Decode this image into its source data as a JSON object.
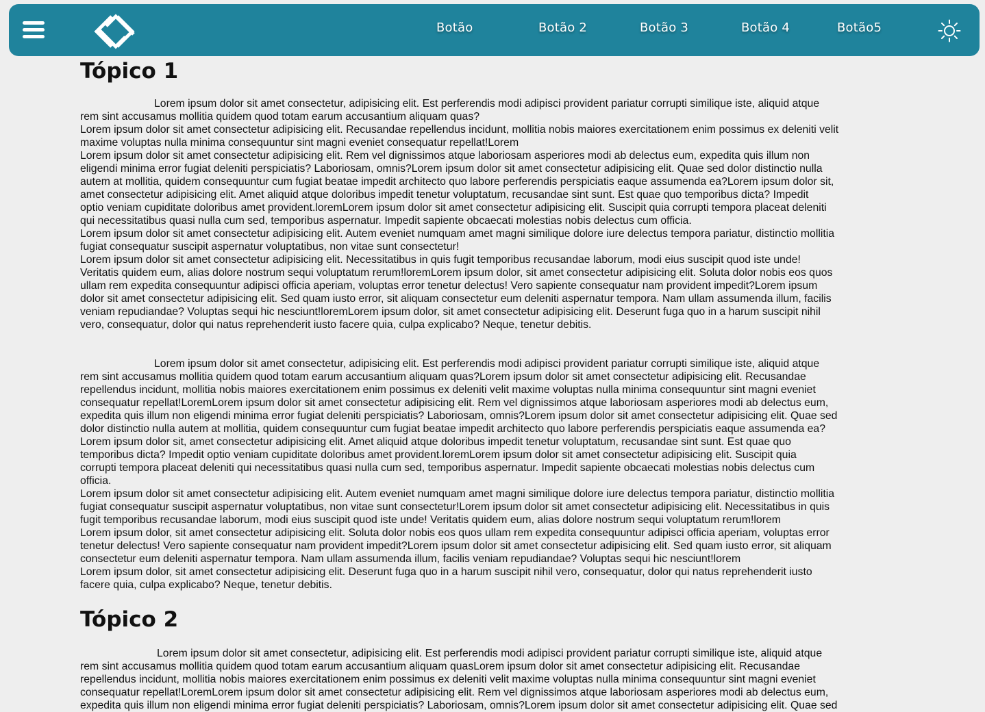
{
  "header": {
    "buttons": [
      "Botão",
      "Botão 2",
      "Botão 3",
      "Botão 4",
      "Botão5"
    ],
    "icons": {
      "menu": "hamburger-menu-icon",
      "logo": "diamond-logo",
      "theme": "sun-icon"
    },
    "colors": {
      "navbar": "#1f839c",
      "background": "#eeeeee"
    }
  },
  "topic1": {
    "title": "Tópico 1",
    "paragraph1": [
      "Lorem ipsum dolor sit amet consectetur, adipisicing elit. Est perferendis modi adipisci provident pariatur corrupti similique iste, aliquid atque",
      "rem sint accusamus mollitia quidem quod totam earum accusantium aliquam quas?",
      "Lorem ipsum dolor sit amet consectetur adipisicing elit. Recusandae repellendus incidunt, mollitia nobis maiores exercitationem enim possimus ex deleniti velit",
      "maxime voluptas nulla minima consequuntur sint magni eveniet consequatur repellat!Lorem",
      "Lorem ipsum dolor sit amet consectetur adipisicing elit. Rem vel dignissimos atque laboriosam asperiores modi ab delectus eum, expedita quis illum non",
      "eligendi minima error fugiat deleniti perspiciatis? Laboriosam, omnis?Lorem ipsum dolor sit amet consectetur adipisicing elit. Quae sed dolor distinctio nulla",
      "autem at mollitia, quidem consequuntur cum fugiat beatae impedit architecto quo labore perferendis perspiciatis eaque assumenda ea?Lorem ipsum dolor sit,",
      "amet consectetur adipisicing elit. Amet aliquid atque doloribus impedit tenetur voluptatum, recusandae sint sunt. Est quae quo temporibus dicta? Impedit",
      "optio veniam cupiditate doloribus amet provident.loremLorem ipsum dolor sit amet consectetur adipisicing elit. Suscipit quia corrupti tempora placeat deleniti",
      "qui necessitatibus quasi nulla cum sed, temporibus aspernatur. Impedit sapiente obcaecati molestias nobis delectus cum officia.",
      "Lorem ipsum dolor sit amet consectetur adipisicing elit. Autem eveniet numquam amet magni similique dolore iure delectus tempora pariatur, distinctio mollitia",
      "fugiat consequatur suscipit aspernatur voluptatibus, non vitae sunt consectetur!",
      "Lorem ipsum dolor sit amet consectetur adipisicing elit. Necessitatibus in quis fugit temporibus recusandae laborum, modi eius suscipit quod iste unde!",
      "Veritatis quidem eum, alias dolore nostrum sequi voluptatum rerum!loremLorem ipsum dolor, sit amet consectetur adipisicing elit. Soluta dolor nobis eos quos",
      "ullam rem expedita consequuntur adipisci officia aperiam, voluptas error tenetur delectus! Vero sapiente consequatur nam provident impedit?Lorem ipsum",
      "dolor sit amet consectetur adipisicing elit. Sed quam iusto error, sit aliquam consectetur eum deleniti aspernatur tempora. Nam ullam assumenda illum, facilis",
      "veniam repudiandae? Voluptas sequi hic nesciunt!loremLorem ipsum dolor, sit amet consectetur adipisicing elit. Deserunt fuga quo in a harum suscipit nihil",
      "vero, consequatur, dolor qui natus reprehenderit iusto facere quia, culpa explicabo? Neque, tenetur debitis."
    ],
    "paragraph2": [
      "Lorem ipsum dolor sit amet consectetur, adipisicing elit. Est perferendis modi adipisci provident pariatur corrupti similique iste, aliquid atque",
      "rem sint accusamus mollitia quidem quod totam earum accusantium aliquam quas?Lorem ipsum dolor sit amet consectetur adipisicing elit. Recusandae",
      "repellendus incidunt, mollitia nobis maiores exercitationem enim possimus ex deleniti velit maxime voluptas nulla minima consequuntur sint magni eveniet",
      "consequatur repellat!LoremLorem ipsum dolor sit amet consectetur adipisicing elit. Rem vel dignissimos atque laboriosam asperiores modi ab delectus eum,",
      "expedita quis illum non eligendi minima error fugiat deleniti perspiciatis? Laboriosam, omnis?Lorem ipsum dolor sit amet consectetur adipisicing elit. Quae sed",
      "dolor distinctio nulla autem at mollitia, quidem consequuntur cum fugiat beatae impedit architecto quo labore perferendis perspiciatis eaque assumenda ea?",
      "Lorem ipsum dolor sit, amet consectetur adipisicing elit. Amet aliquid atque doloribus impedit tenetur voluptatum, recusandae sint sunt. Est quae quo",
      "temporibus dicta? Impedit optio veniam cupiditate doloribus amet provident.loremLorem ipsum dolor sit amet consectetur adipisicing elit. Suscipit quia",
      "corrupti tempora placeat deleniti qui necessitatibus quasi nulla cum sed, temporibus aspernatur. Impedit sapiente obcaecati molestias nobis delectus cum",
      "officia.",
      "Lorem ipsum dolor sit amet consectetur adipisicing elit. Autem eveniet numquam amet magni similique dolore iure delectus tempora pariatur, distinctio mollitia",
      "fugiat consequatur suscipit aspernatur voluptatibus, non vitae sunt consectetur!Lorem ipsum dolor sit amet consectetur adipisicing elit. Necessitatibus in quis",
      "fugit temporibus recusandae laborum, modi eius suscipit quod iste unde! Veritatis quidem eum, alias dolore nostrum sequi voluptatum rerum!lorem",
      "Lorem ipsum dolor, sit amet consectetur adipisicing elit. Soluta dolor nobis eos quos ullam rem expedita consequuntur adipisci officia aperiam, voluptas error",
      "tenetur delectus! Vero sapiente consequatur nam provident impedit?Lorem ipsum dolor sit amet consectetur adipisicing elit. Sed quam iusto error, sit aliquam",
      "consectetur eum deleniti aspernatur tempora. Nam ullam assumenda illum, facilis veniam repudiandae? Voluptas sequi hic nesciunt!lorem",
      "Lorem ipsum dolor, sit amet consectetur adipisicing elit. Deserunt fuga quo in a harum suscipit nihil vero, consequatur, dolor qui natus reprehenderit iusto",
      "facere quia, culpa explicabo? Neque, tenetur debitis."
    ]
  },
  "topic2": {
    "title": "Tópico 2",
    "paragraph1": [
      "Lorem ipsum dolor sit amet consectetur, adipisicing elit. Est perferendis modi adipisci provident pariatur corrupti similique iste, aliquid atque",
      "rem sint accusamus mollitia quidem quod totam earum accusantium aliquam quasLorem ipsum dolor sit amet consectetur adipisicing elit. Recusandae",
      "repellendus incidunt, mollitia nobis maiores exercitationem enim possimus ex deleniti velit maxime voluptas nulla minima consequuntur sint magni eveniet",
      "consequatur repellat!LoremLorem ipsum dolor sit amet consectetur adipisicing elit. Rem vel dignissimos atque laboriosam asperiores modi ab delectus eum,",
      "expedita quis illum non eligendi minima error fugiat deleniti perspiciatis? Laboriosam, omnis?Lorem ipsum dolor sit amet consectetur adipisicing elit. Quae sed"
    ]
  }
}
